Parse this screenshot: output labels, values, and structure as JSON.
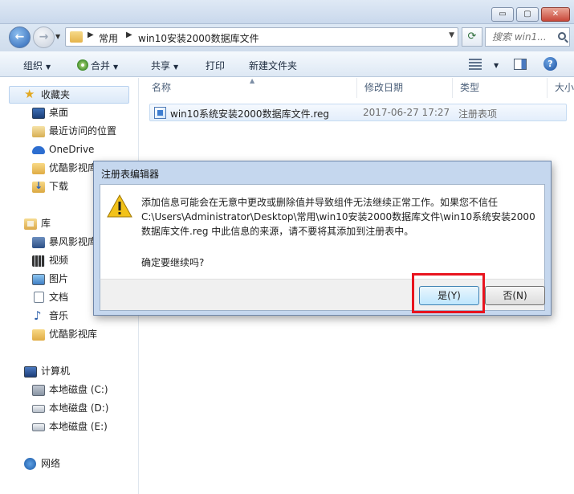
{
  "window": {
    "minimize": "▭",
    "maximize": "▢",
    "close": "✕"
  },
  "address": {
    "crumbs": [
      "常用",
      "win10安装2000数据库文件"
    ],
    "search_placeholder": "搜索 win1..."
  },
  "toolbar": {
    "organize": "组织",
    "burn": "合并",
    "share": "共享",
    "print": "打印",
    "new_folder": "新建文件夹",
    "help": "?"
  },
  "sidebar": {
    "favorites": {
      "label": "收藏夹",
      "items": [
        "桌面",
        "最近访问的位置",
        "OneDrive",
        "优酷影视库",
        "下载"
      ]
    },
    "libraries": {
      "label": "库",
      "items": [
        "暴风影视库",
        "视频",
        "图片",
        "文档",
        "音乐",
        "优酷影视库"
      ]
    },
    "computer": {
      "label": "计算机",
      "items": [
        "本地磁盘 (C:)",
        "本地磁盘 (D:)",
        "本地磁盘 (E:)"
      ]
    },
    "network": {
      "label": "网络"
    }
  },
  "columns": {
    "name": "名称",
    "date": "修改日期",
    "type": "类型",
    "size": "大小"
  },
  "files": [
    {
      "name": "win10系统安装2000数据库文件.reg",
      "date": "2017-06-27 17:27",
      "type": "注册表项"
    }
  ],
  "dialog": {
    "title": "注册表编辑器",
    "message_lines": [
      "添加信息可能会在无意中更改或删除值并导致组件无法继续正常工作。如果您不信任",
      "C:\\Users\\Administrator\\Desktop\\常用\\win10安装2000数据库文件\\win10系统安装2000",
      "数据库文件.reg 中此信息的来源，请不要将其添加到注册表中。"
    ],
    "confirm": "确定要继续吗?",
    "yes_label": "是(Y)",
    "no_label": "否(N)"
  },
  "colors": {
    "highlight": "#e8141e",
    "selection": "#dbe9f8"
  }
}
